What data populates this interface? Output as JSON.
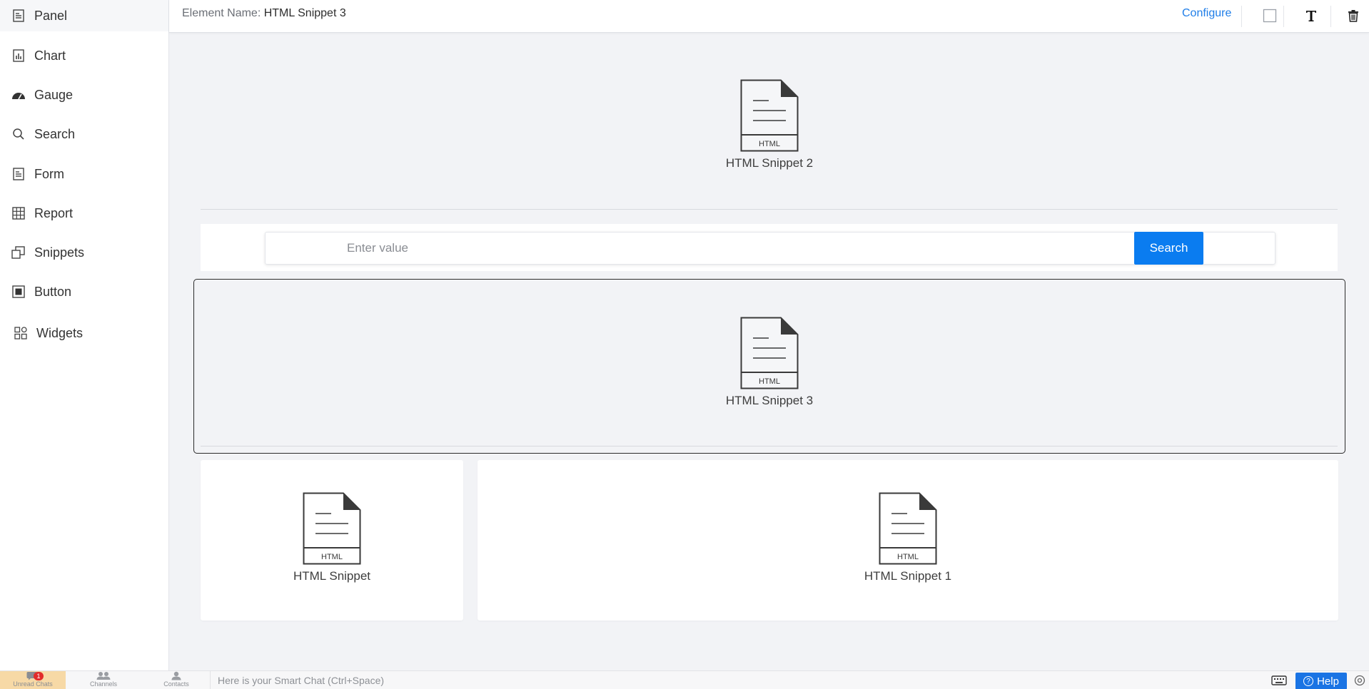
{
  "sidebar": {
    "items": [
      {
        "label": "Panel",
        "icon": "panel-icon"
      },
      {
        "label": "Chart",
        "icon": "chart-icon"
      },
      {
        "label": "Gauge",
        "icon": "gauge-icon"
      },
      {
        "label": "Search",
        "icon": "search-icon"
      },
      {
        "label": "Form",
        "icon": "form-icon"
      },
      {
        "label": "Report",
        "icon": "report-grid-icon"
      },
      {
        "label": "Snippets",
        "icon": "snippets-icon"
      },
      {
        "label": "Button",
        "icon": "button-icon"
      },
      {
        "label": "Widgets",
        "icon": "widgets-icon"
      }
    ]
  },
  "topbar": {
    "element_name_label": "Element Name:",
    "element_name_value": "HTML Snippet 3",
    "configure_label": "Configure"
  },
  "canvas": {
    "html_badge": "HTML",
    "snippet_2_label": "HTML Snippet 2",
    "snippet_3_label": "HTML Snippet 3",
    "snippet_label": "HTML Snippet",
    "snippet_1_label": "HTML Snippet 1",
    "search": {
      "placeholder": "Enter value",
      "button_label": "Search"
    }
  },
  "bottombar": {
    "unread_chats_label": "Unread Chats",
    "unread_count": "1",
    "channels_label": "Channels",
    "contacts_label": "Contacts",
    "smart_chat_placeholder": "Here is your Smart Chat (Ctrl+Space)",
    "help_label": "Help"
  },
  "colors": {
    "accent": "#0a7cf0",
    "link": "#1f7ee8",
    "badge": "#e22b2b",
    "unread_tab": "#f7d9a6"
  }
}
